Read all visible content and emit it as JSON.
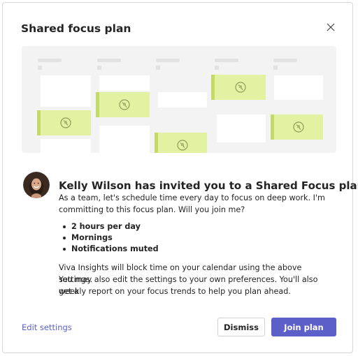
{
  "dialog": {
    "title": "Shared focus plan",
    "close_icon": "close-icon"
  },
  "illustration": {
    "focus_icon": "focus-do-not-disturb-icon",
    "colors": {
      "background": "#f3f3f3",
      "focus_block": "#e3f1a3",
      "focus_accent": "#c3d968"
    }
  },
  "invite": {
    "heading": "Kelly Wilson has invited you to a Shared Focus plan",
    "message_line1": "As a team, let's schedule time every day to focus on deep work. I'm",
    "message_line2": "committing to this focus plan. Will you join me?",
    "settings": [
      "2 hours per day",
      "Mornings",
      "Notifications muted"
    ],
    "note_line1": "Viva Insights will block time on your calendar using the above settings.",
    "note_line2": "You may also edit the settings to your own preferences. You'll also get a",
    "note_line3": "weekly report on your focus trends to help you plan ahead."
  },
  "footer": {
    "edit_settings_label": "Edit settings",
    "dismiss_label": "Dismiss",
    "join_label": "Join plan"
  },
  "colors": {
    "primary": "#5b5fc7",
    "text": "#242424"
  }
}
